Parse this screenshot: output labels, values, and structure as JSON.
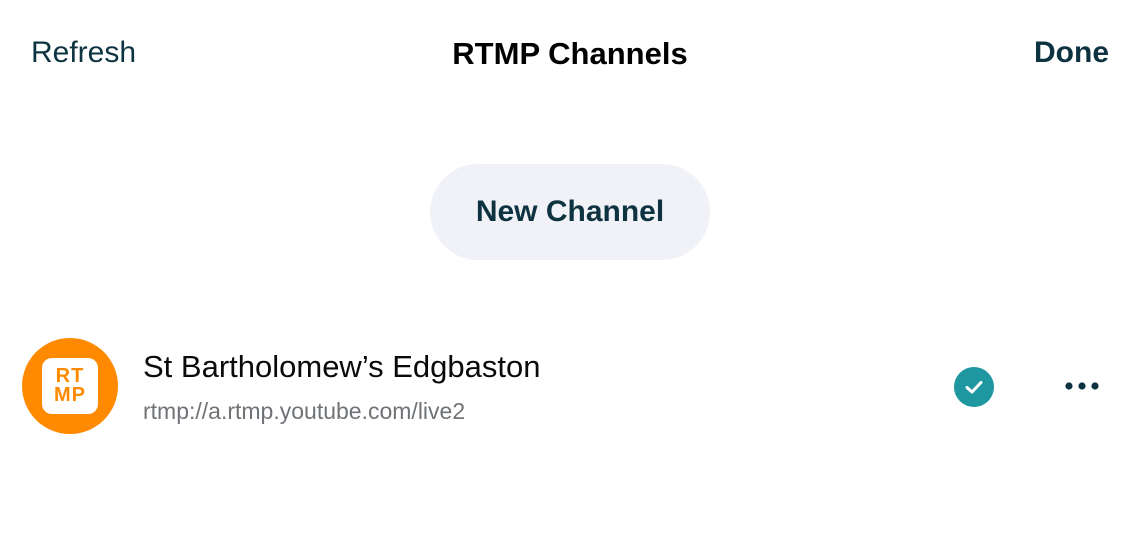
{
  "nav": {
    "left_label": "Refresh",
    "title": "RTMP Channels",
    "right_label": "Done"
  },
  "actions": {
    "new_channel_label": "New Channel"
  },
  "channels": [
    {
      "avatar_line1": "RT",
      "avatar_line2": "MP",
      "name": "St Bartholomew’s Edgbaston",
      "url": "rtmp://a.rtmp.youtube.com/live2",
      "selected": true,
      "status_icon": "checkmark-circle-icon",
      "menu_icon": "more-horizontal-icon"
    }
  ],
  "colors": {
    "accent_dark": "#0e3340",
    "avatar_orange": "#ff8a00",
    "check_teal": "#1e97a0",
    "button_bg": "#f0f2f7"
  }
}
